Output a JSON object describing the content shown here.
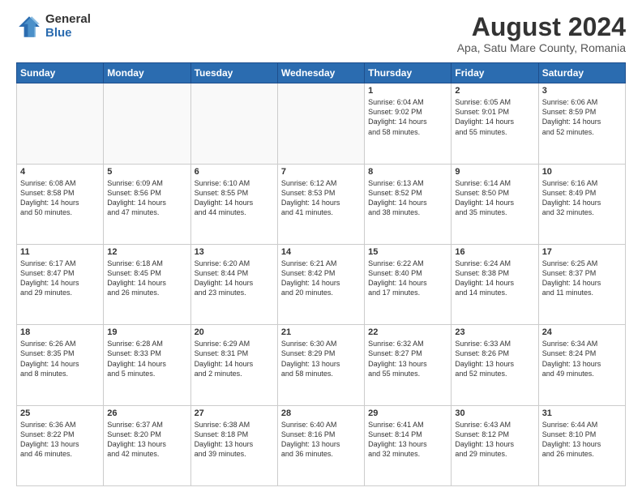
{
  "logo": {
    "general": "General",
    "blue": "Blue"
  },
  "header": {
    "title": "August 2024",
    "subtitle": "Apa, Satu Mare County, Romania"
  },
  "days_of_week": [
    "Sunday",
    "Monday",
    "Tuesday",
    "Wednesday",
    "Thursday",
    "Friday",
    "Saturday"
  ],
  "weeks": [
    [
      {
        "day": "",
        "info": ""
      },
      {
        "day": "",
        "info": ""
      },
      {
        "day": "",
        "info": ""
      },
      {
        "day": "",
        "info": ""
      },
      {
        "day": "1",
        "info": "Sunrise: 6:04 AM\nSunset: 9:02 PM\nDaylight: 14 hours\nand 58 minutes."
      },
      {
        "day": "2",
        "info": "Sunrise: 6:05 AM\nSunset: 9:01 PM\nDaylight: 14 hours\nand 55 minutes."
      },
      {
        "day": "3",
        "info": "Sunrise: 6:06 AM\nSunset: 8:59 PM\nDaylight: 14 hours\nand 52 minutes."
      }
    ],
    [
      {
        "day": "4",
        "info": "Sunrise: 6:08 AM\nSunset: 8:58 PM\nDaylight: 14 hours\nand 50 minutes."
      },
      {
        "day": "5",
        "info": "Sunrise: 6:09 AM\nSunset: 8:56 PM\nDaylight: 14 hours\nand 47 minutes."
      },
      {
        "day": "6",
        "info": "Sunrise: 6:10 AM\nSunset: 8:55 PM\nDaylight: 14 hours\nand 44 minutes."
      },
      {
        "day": "7",
        "info": "Sunrise: 6:12 AM\nSunset: 8:53 PM\nDaylight: 14 hours\nand 41 minutes."
      },
      {
        "day": "8",
        "info": "Sunrise: 6:13 AM\nSunset: 8:52 PM\nDaylight: 14 hours\nand 38 minutes."
      },
      {
        "day": "9",
        "info": "Sunrise: 6:14 AM\nSunset: 8:50 PM\nDaylight: 14 hours\nand 35 minutes."
      },
      {
        "day": "10",
        "info": "Sunrise: 6:16 AM\nSunset: 8:49 PM\nDaylight: 14 hours\nand 32 minutes."
      }
    ],
    [
      {
        "day": "11",
        "info": "Sunrise: 6:17 AM\nSunset: 8:47 PM\nDaylight: 14 hours\nand 29 minutes."
      },
      {
        "day": "12",
        "info": "Sunrise: 6:18 AM\nSunset: 8:45 PM\nDaylight: 14 hours\nand 26 minutes."
      },
      {
        "day": "13",
        "info": "Sunrise: 6:20 AM\nSunset: 8:44 PM\nDaylight: 14 hours\nand 23 minutes."
      },
      {
        "day": "14",
        "info": "Sunrise: 6:21 AM\nSunset: 8:42 PM\nDaylight: 14 hours\nand 20 minutes."
      },
      {
        "day": "15",
        "info": "Sunrise: 6:22 AM\nSunset: 8:40 PM\nDaylight: 14 hours\nand 17 minutes."
      },
      {
        "day": "16",
        "info": "Sunrise: 6:24 AM\nSunset: 8:38 PM\nDaylight: 14 hours\nand 14 minutes."
      },
      {
        "day": "17",
        "info": "Sunrise: 6:25 AM\nSunset: 8:37 PM\nDaylight: 14 hours\nand 11 minutes."
      }
    ],
    [
      {
        "day": "18",
        "info": "Sunrise: 6:26 AM\nSunset: 8:35 PM\nDaylight: 14 hours\nand 8 minutes."
      },
      {
        "day": "19",
        "info": "Sunrise: 6:28 AM\nSunset: 8:33 PM\nDaylight: 14 hours\nand 5 minutes."
      },
      {
        "day": "20",
        "info": "Sunrise: 6:29 AM\nSunset: 8:31 PM\nDaylight: 14 hours\nand 2 minutes."
      },
      {
        "day": "21",
        "info": "Sunrise: 6:30 AM\nSunset: 8:29 PM\nDaylight: 13 hours\nand 58 minutes."
      },
      {
        "day": "22",
        "info": "Sunrise: 6:32 AM\nSunset: 8:27 PM\nDaylight: 13 hours\nand 55 minutes."
      },
      {
        "day": "23",
        "info": "Sunrise: 6:33 AM\nSunset: 8:26 PM\nDaylight: 13 hours\nand 52 minutes."
      },
      {
        "day": "24",
        "info": "Sunrise: 6:34 AM\nSunset: 8:24 PM\nDaylight: 13 hours\nand 49 minutes."
      }
    ],
    [
      {
        "day": "25",
        "info": "Sunrise: 6:36 AM\nSunset: 8:22 PM\nDaylight: 13 hours\nand 46 minutes."
      },
      {
        "day": "26",
        "info": "Sunrise: 6:37 AM\nSunset: 8:20 PM\nDaylight: 13 hours\nand 42 minutes."
      },
      {
        "day": "27",
        "info": "Sunrise: 6:38 AM\nSunset: 8:18 PM\nDaylight: 13 hours\nand 39 minutes."
      },
      {
        "day": "28",
        "info": "Sunrise: 6:40 AM\nSunset: 8:16 PM\nDaylight: 13 hours\nand 36 minutes."
      },
      {
        "day": "29",
        "info": "Sunrise: 6:41 AM\nSunset: 8:14 PM\nDaylight: 13 hours\nand 32 minutes."
      },
      {
        "day": "30",
        "info": "Sunrise: 6:43 AM\nSunset: 8:12 PM\nDaylight: 13 hours\nand 29 minutes."
      },
      {
        "day": "31",
        "info": "Sunrise: 6:44 AM\nSunset: 8:10 PM\nDaylight: 13 hours\nand 26 minutes."
      }
    ]
  ]
}
